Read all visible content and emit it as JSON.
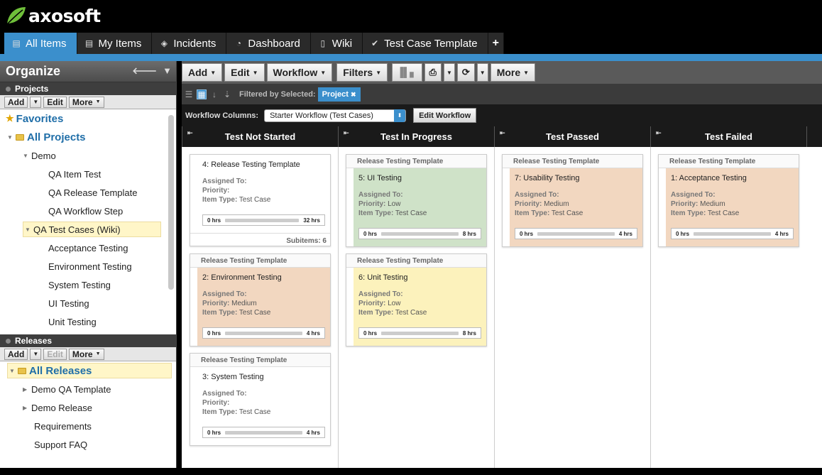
{
  "app": {
    "logo_text": "axosoft"
  },
  "tabs": [
    {
      "label": "All Items",
      "icon": "inbox-icon",
      "glyph": "▤"
    },
    {
      "label": "My Items",
      "icon": "list-icon",
      "glyph": "▤"
    },
    {
      "label": "Incidents",
      "icon": "tag-icon",
      "glyph": "◈"
    },
    {
      "label": "Dashboard",
      "icon": "dashboard-icon",
      "glyph": "◔"
    },
    {
      "label": "Wiki",
      "icon": "document-icon",
      "glyph": "▯"
    },
    {
      "label": "Test Case Template",
      "icon": "check-circle-icon",
      "glyph": "✔"
    },
    {
      "label": "+",
      "icon": "plus-icon"
    }
  ],
  "sidebar": {
    "title": "Organize",
    "projects_title": "Projects",
    "projects_toolbar": {
      "add": "Add",
      "edit": "Edit",
      "more": "More"
    },
    "tree": {
      "favorites": "Favorites",
      "all_projects": "All Projects",
      "demo": "Demo",
      "demo_children": [
        "QA Item Test",
        "QA Release Template",
        "QA Workflow Step"
      ],
      "qa_test_cases": "QA Test Cases (Wiki)",
      "qa_children": [
        "Acceptance Testing",
        "Environment Testing",
        "System Testing",
        "UI Testing",
        "Unit Testing"
      ]
    },
    "releases_title": "Releases",
    "releases_toolbar": {
      "add": "Add",
      "edit": "Edit",
      "more": "More"
    },
    "releases": {
      "all_releases": "All Releases",
      "items": [
        "Demo QA Template",
        "Demo Release",
        "Requirements",
        "Support FAQ"
      ]
    }
  },
  "toolbar": {
    "add": "Add",
    "edit": "Edit",
    "workflow": "Workflow",
    "filters": "Filters",
    "more": "More"
  },
  "filterbar": {
    "label": "Filtered by Selected:",
    "chip": "Project",
    "chip_close": "✖"
  },
  "workflow": {
    "label": "Workflow Columns:",
    "selected": "Starter Workflow (Test Cases)",
    "edit_button": "Edit Workflow"
  },
  "columns": [
    {
      "title": "Test Not Started"
    },
    {
      "title": "Test In Progress"
    },
    {
      "title": "Test Passed"
    },
    {
      "title": "Test Failed"
    }
  ],
  "cards": [
    {
      "parent": "",
      "title": "4: Release Testing Template",
      "assigned_label": "Assigned To:",
      "assigned": "",
      "priority_label": "Priority:",
      "priority": "",
      "type_label": "Item Type:",
      "type": "Test Case",
      "hrs_start": "0 hrs",
      "hrs_end": "32 hrs",
      "subitems": "Subitems: 6",
      "color": "white"
    },
    {
      "parent": "Release Testing Template",
      "title": "2: Environment Testing",
      "assigned_label": "Assigned To:",
      "assigned": "",
      "priority_label": "Priority:",
      "priority": "Medium",
      "type_label": "Item Type:",
      "type": "Test Case",
      "hrs_start": "0 hrs",
      "hrs_end": "4 hrs",
      "color": "orange"
    },
    {
      "parent": "Release Testing Template",
      "title": "3: System Testing",
      "assigned_label": "Assigned To:",
      "assigned": "",
      "priority_label": "Priority:",
      "priority": "",
      "type_label": "Item Type:",
      "type": "Test Case",
      "hrs_start": "0 hrs",
      "hrs_end": "4 hrs",
      "color": "white"
    },
    {
      "parent": "Release Testing Template",
      "title": "5: UI Testing",
      "assigned_label": "Assigned To:",
      "assigned": "",
      "priority_label": "Priority:",
      "priority": "Low",
      "type_label": "Item Type:",
      "type": "Test Case",
      "hrs_start": "0 hrs",
      "hrs_end": "8 hrs",
      "color": "green"
    },
    {
      "parent": "Release Testing Template",
      "title": "6: Unit Testing",
      "assigned_label": "Assigned To:",
      "assigned": "",
      "priority_label": "Priority:",
      "priority": "Low",
      "type_label": "Item Type:",
      "type": "Test Case",
      "hrs_start": "0 hrs",
      "hrs_end": "8 hrs",
      "color": "yellow"
    },
    {
      "parent": "Release Testing Template",
      "title": "7: Usability Testing",
      "assigned_label": "Assigned To:",
      "assigned": "",
      "priority_label": "Priority:",
      "priority": "Medium",
      "type_label": "Item Type:",
      "type": "Test Case",
      "hrs_start": "0 hrs",
      "hrs_end": "4 hrs",
      "color": "orange"
    },
    {
      "parent": "Release Testing Template",
      "title": "1: Acceptance Testing",
      "assigned_label": "Assigned To:",
      "assigned": "",
      "priority_label": "Priority:",
      "priority": "Medium",
      "type_label": "Item Type:",
      "type": "Test Case",
      "hrs_start": "0 hrs",
      "hrs_end": "4 hrs",
      "color": "orange"
    }
  ],
  "colors": {
    "accent": "#3b8fcc",
    "green": "#cfe2c8",
    "orange": "#f2d7c0",
    "yellow": "#fcf2bc"
  }
}
